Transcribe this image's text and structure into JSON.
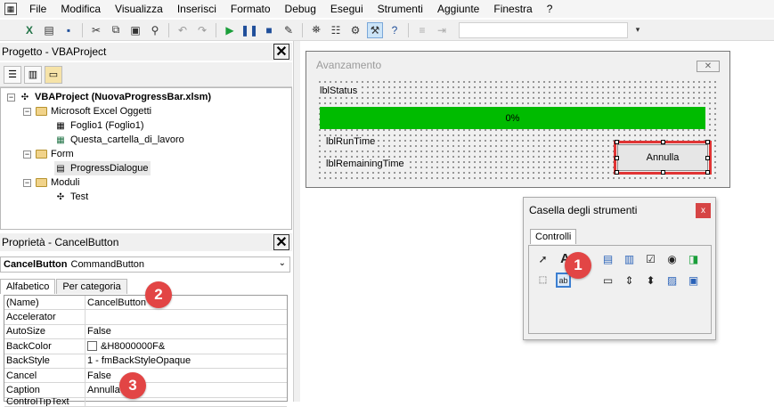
{
  "menu": {
    "items": [
      "File",
      "Modifica",
      "Visualizza",
      "Inserisci",
      "Formato",
      "Debug",
      "Esegui",
      "Strumenti",
      "Aggiunte",
      "Finestra",
      "?"
    ]
  },
  "project_panel": {
    "title": "Progetto - VBAProject",
    "root": "VBAProject (NuovaProgressBar.xlsm)",
    "excel_objects_folder": "Microsoft Excel Oggetti",
    "sheet1": "Foglio1 (Foglio1)",
    "workbook": "Questa_cartella_di_lavoro",
    "forms_folder": "Form",
    "form_item": "ProgressDialogue",
    "modules_folder": "Moduli",
    "module_item": "Test"
  },
  "properties_panel": {
    "title": "Proprietà - CancelButton",
    "object_name": "CancelButton",
    "object_type": "CommandButton",
    "tab_alpha": "Alfabetico",
    "tab_category": "Per categoria",
    "rows": [
      {
        "name": "(Name)",
        "value": "CancelButton"
      },
      {
        "name": "Accelerator",
        "value": ""
      },
      {
        "name": "AutoSize",
        "value": "False"
      },
      {
        "name": "BackColor",
        "value": "&H8000000F&"
      },
      {
        "name": "BackStyle",
        "value": "1 - fmBackStyleOpaque"
      },
      {
        "name": "Cancel",
        "value": "False"
      },
      {
        "name": "Caption",
        "value": "Annulla"
      },
      {
        "name": "ControlTipText",
        "value": ""
      }
    ]
  },
  "form": {
    "title": "Avanzamento",
    "lbl_status": "lblStatus",
    "progress_text": "0%",
    "progress_percent": 0,
    "lbl_runtime": "lblRunTime",
    "lbl_remaining": "lblRemainingTime",
    "cancel_caption": "Annulla"
  },
  "toolbox": {
    "title": "Casella degli strumenti",
    "close_glyph": "x",
    "tab": "Controlli"
  },
  "annotations": {
    "badge1": "1",
    "badge2": "2",
    "badge3": "3"
  },
  "colors": {
    "progress_fill": "#00bb00",
    "highlight_red": "#e03434",
    "badge_red": "#e24545"
  }
}
